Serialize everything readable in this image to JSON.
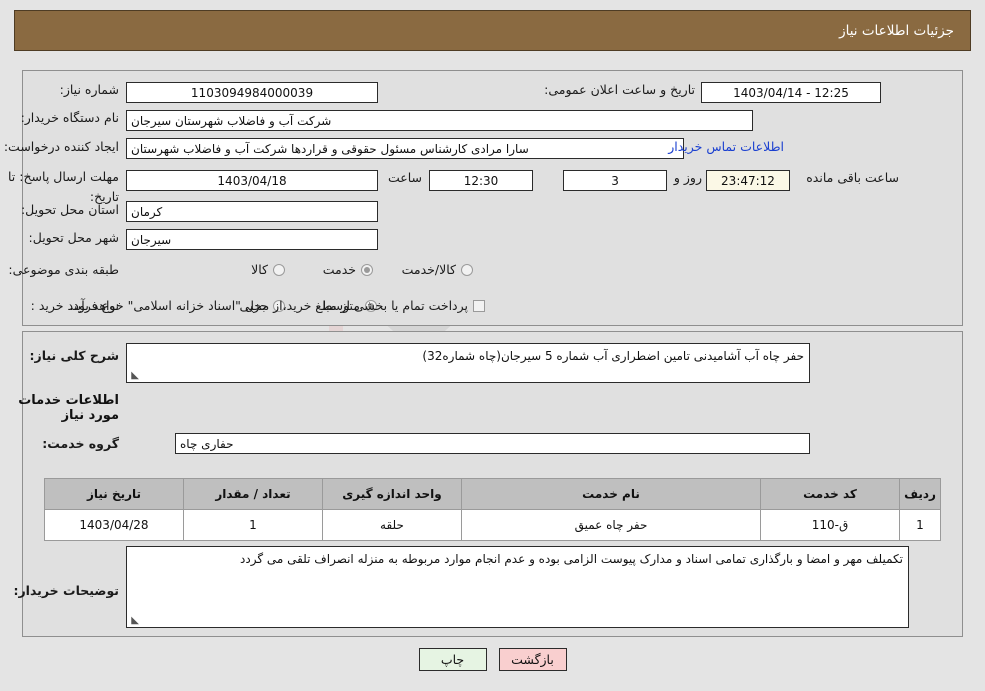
{
  "header": {
    "title": "جزئیات اطلاعات نیاز"
  },
  "form": {
    "need_number_label": "شماره نیاز:",
    "need_number_value": "1103094984000039",
    "announce_label": "تاریخ و ساعت اعلان عمومی:",
    "announce_value": "12:25 - 1403/04/14",
    "buyer_org_label": "نام دستگاه خریدار:",
    "buyer_org_value": "شرکت آب و فاضلاب شهرستان سیرجان",
    "requester_label": "ایجاد کننده درخواست:",
    "requester_value": "سارا مرادی کارشناس مسئول حقوقی و قراردها شرکت آب و فاضلاب شهرستان",
    "contact_link": "اطلاعات تماس خریدار",
    "deadline_label": "مهلت ارسال پاسخ: تا تاریخ:",
    "deadline_date": "1403/04/18",
    "time_label": "ساعت",
    "deadline_time": "12:30",
    "days_value": "3",
    "days_label": "روز و",
    "countdown_value": "23:47:12",
    "countdown_label": "ساعت باقی مانده",
    "province_label": "استان محل تحویل:",
    "province_value": "کرمان",
    "city_label": "شهر محل تحویل:",
    "city_value": "سیرجان",
    "category_label": "طبقه بندی موضوعی:",
    "category_options": [
      {
        "label": "کالا",
        "selected": false
      },
      {
        "label": "خدمت",
        "selected": true
      },
      {
        "label": "کالا/خدمت",
        "selected": false
      }
    ],
    "process_label": "نوع فرآیند خرید :",
    "process_options": [
      {
        "label": "جزیی",
        "selected": false
      },
      {
        "label": "متوسط",
        "selected": true
      }
    ],
    "treasury_checkbox_checked": false,
    "treasury_text": "پرداخت تمام یا بخشی از مبلغ خرید،از محل \"اسناد خزانه اسلامی\" خواهد بود."
  },
  "description": {
    "label": "شرح کلی نیاز:",
    "value": "حفر چاه آب آشامیدنی تامین اضطراری آب شماره 5 سیرجان(چاه شماره32)"
  },
  "services": {
    "section_title": "اطلاعات خدمات مورد نیاز",
    "group_label": "گروه خدمت:",
    "group_value": "حفاری چاه",
    "table": {
      "columns": [
        "ردیف",
        "کد خدمت",
        "نام خدمت",
        "واحد اندازه گیری",
        "تعداد / مقدار",
        "تاریخ نیاز"
      ],
      "rows": [
        [
          "1",
          "ق-110",
          "حفر چاه عمیق",
          "حلقه",
          "1",
          "1403/04/28"
        ]
      ]
    }
  },
  "buyer_notes": {
    "label": "توضیحات خریدار:",
    "value": "تکمیلف مهر و امضا و بارگذاری تمامی اسناد و مدارک پیوست الزامی بوده و عدم انجام موارد مربوطه به منزله انصراف تلقی می گردد"
  },
  "buttons": {
    "print": "چاپ",
    "back": "بازگشت"
  },
  "watermark": {
    "text": "AriaTender.net"
  },
  "colors": {
    "header_bg": "#8a6a41",
    "panel_bg": "#e0e0e0",
    "page_bg": "#e4e4e4",
    "link": "#1a3fd0",
    "table_header_bg": "#bfbfbf",
    "back_button_bg": "#f9cfcf",
    "print_button_bg": "#e6f4e3",
    "countdown_bg": "#fbf8e6"
  }
}
